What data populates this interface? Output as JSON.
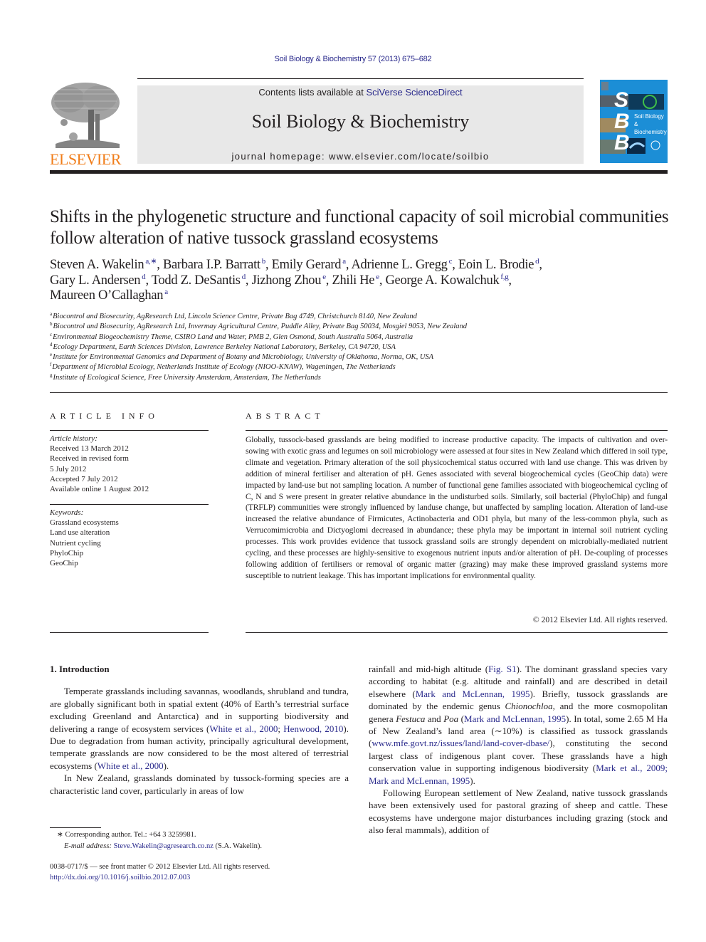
{
  "citation": "Soil Biology & Biochemistry 57 (2013) 675–682",
  "header": {
    "publisher_logo_text": "ELSEVIER",
    "contents_prefix": "Contents lists available at ",
    "contents_link": "SciVerse ScienceDirect",
    "journal_title": "Soil Biology & Biochemistry",
    "homepage_prefix": "journal homepage: ",
    "homepage_url": "www.elsevier.com/locate/soilbio",
    "cover": {
      "letters": [
        "S",
        "B",
        "B"
      ],
      "cover_title_line1": "Soil Biology &",
      "cover_title_line2": "Biochemistry",
      "background_color": "#1c8ed6"
    },
    "brand_orange": "#f07d1a",
    "link_color": "#2a2a8c"
  },
  "article": {
    "title": "Shifts in the phylogenetic structure and functional capacity of soil microbial communities follow alteration of native tussock grassland ecosystems",
    "authors": [
      {
        "name": "Steven A. Wakelin",
        "aff": "a,∗",
        "sep": ", "
      },
      {
        "name": "Barbara I.P. Barratt",
        "aff": "b",
        "sep": ", "
      },
      {
        "name": "Emily Gerard",
        "aff": "a",
        "sep": ", "
      },
      {
        "name": "Adrienne L. Gregg",
        "aff": "c",
        "sep": ", "
      },
      {
        "name": "Eoin L. Brodie",
        "aff": "d",
        "sep": ","
      },
      {
        "name": "Gary L. Andersen",
        "aff": "d",
        "sep": ", "
      },
      {
        "name": "Todd Z. DeSantis",
        "aff": "d",
        "sep": ", "
      },
      {
        "name": "Jizhong Zhou",
        "aff": "e",
        "sep": ", "
      },
      {
        "name": "Zhili He",
        "aff": "e",
        "sep": ", "
      },
      {
        "name": "George A. Kowalchuk",
        "aff": "f,g",
        "sep": ","
      },
      {
        "name": "Maureen O’Callaghan",
        "aff": "a",
        "sep": ""
      }
    ],
    "affiliations": [
      {
        "key": "a",
        "text": "Biocontrol and Biosecurity, AgResearch Ltd, Lincoln Science Centre, Private Bag 4749, Christchurch 8140, New Zealand"
      },
      {
        "key": "b",
        "text": "Biocontrol and Biosecurity, AgResearch Ltd, Invermay Agricultural Centre, Puddle Alley, Private Bag 50034, Mosgiel 9053, New Zealand"
      },
      {
        "key": "c",
        "text": "Environmental Biogeochemistry Theme, CSIRO Land and Water, PMB 2, Glen Osmond, South Australia 5064, Australia"
      },
      {
        "key": "d",
        "text": "Ecology Department, Earth Sciences Division, Lawrence Berkeley National Laboratory, Berkeley, CA 94720, USA"
      },
      {
        "key": "e",
        "text": "Institute for Environmental Genomics and Department of Botany and Microbiology, University of Oklahoma, Norma, OK, USA"
      },
      {
        "key": "f",
        "text": "Department of Microbial Ecology, Netherlands Institute of Ecology (NIOO-KNAW), Wageningen, The Netherlands"
      },
      {
        "key": "g",
        "text": "Institute of Ecological Science, Free University Amsterdam, Amsterdam, The Netherlands"
      }
    ]
  },
  "article_info": {
    "heading": "ARTICLE INFO",
    "history_label": "Article history:",
    "history": [
      "Received 13 March 2012",
      "Received in revised form",
      "5 July 2012",
      "Accepted 7 July 2012",
      "Available online 1 August 2012"
    ],
    "keywords_label": "Keywords:",
    "keywords": [
      "Grassland ecosystems",
      "Land use alteration",
      "Nutrient cycling",
      "PhyloChip",
      "GeoChip"
    ]
  },
  "abstract": {
    "heading": "ABSTRACT",
    "text": "Globally, tussock-based grasslands are being modified to increase productive capacity. The impacts of cultivation and over-sowing with exotic grass and legumes on soil microbiology were assessed at four sites in New Zealand which differed in soil type, climate and vegetation. Primary alteration of the soil physicochemical status occurred with land use change. This was driven by addition of mineral fertiliser and alteration of pH. Genes associated with several biogeochemical cycles (GeoChip data) were impacted by land-use but not sampling location. A number of functional gene families associated with biogeo­chemical cycling of C, N and S were present in greater relative abundance in the undisturbed soils. Similarly, soil bacterial (PhyloChip) and fungal (TRFLP) communities were strongly influenced by land­use change, but unaffected by sampling location. Alteration of land-use increased the relative abundance of Firmicutes, Actinobacteria and OD1 phyla, but many of the less-common phyla, such as Verrucomi­microbia and Dictyoglomi decreased in abundance; these phyla may be important in internal soil nutrient cycling processes. This work provides evidence that tussock grassland soils are strongly dependent on microbially-mediated nutrient cycling, and these processes are highly-sensitive to exogenous nutrient inputs and/or alteration of pH. De-coupling of processes following addition of fertilisers or removal of organic matter (grazing) may make these improved grassland systems more susceptible to nutrient leakage. This has important implications for environmental quality.",
    "copyright": "© 2012 Elsevier Ltd. All rights reserved."
  },
  "body": {
    "section_title": "1.  Introduction",
    "left": {
      "p1_a": "Temperate grasslands including savannas, woodlands, shrub­land and tundra, are globally significant both in spatial extent (40% of Earth’s terrestrial surface excluding Greenland and Antarctica) and in supporting biodiversity and delivering a range of ecosystem services (",
      "p1_ref1": "White et al., 2000",
      "p1_b": "; ",
      "p1_ref2": "Henwood, 2010",
      "p1_c": "). Due to degradation from human activity, principally agricultural development, temperate grasslands are now considered to be the most altered of terrestrial ecosystems (",
      "p1_ref3": "White et al., 2000",
      "p1_d": ").",
      "p2": "In New Zealand, grasslands dominated by tussock-forming species are a characteristic land cover, particularly in areas of low"
    },
    "right": {
      "p1_a": "rainfall and mid-high altitude (",
      "p1_ref1": "Fig. S1",
      "p1_b": "). The dominant grassland species vary according to habitat (e.g. altitude and rainfall) and are described in detail elsewhere (",
      "p1_ref2": "Mark and McLennan, 1995",
      "p1_c": "). Briefly, tussock grasslands are dominated by the endemic genus ",
      "p1_genus1": "Chiono­chloa",
      "p1_d": ", and the more cosmopolitan genera ",
      "p1_genus2": "Festuca",
      "p1_e": " and ",
      "p1_genus3": "Poa",
      "p1_f": " (",
      "p1_ref3": "Mark and McLennan, 1995",
      "p1_g": "). In total, some 2.65 M Ha of New Zealand’s land area (∼10%) is classified as tussock grasslands (",
      "p1_url": "www.mfe.govt.nz/issues/land/land-cover-dbase/",
      "p1_h": "), constituting the second largest class of indigenous plant cover. These grasslands have a high conservation value in supporting indigenous biodiversity (",
      "p1_ref4": "Mark et al., 2009; Mark and McLennan, 1995",
      "p1_i": ").",
      "p2": "Following European settlement of New Zealand, native tussock grasslands have been extensively used for pastoral grazing of sheep and cattle. These ecosystems have undergone major disturbances including grazing (stock and also feral mammals), addition of"
    }
  },
  "footnote": {
    "marker": "∗",
    "corresponding": "Corresponding author. Tel.: +64 3 3259981.",
    "email_label": "E-mail address: ",
    "email": "Steve.Wakelin@agresearch.co.nz",
    "email_suffix": " (S.A. Wakelin).",
    "frontmatter": "0038-0717/$ — see front matter © 2012 Elsevier Ltd. All rights reserved.",
    "doi": "http://dx.doi.org/10.1016/j.soilbio.2012.07.003"
  }
}
